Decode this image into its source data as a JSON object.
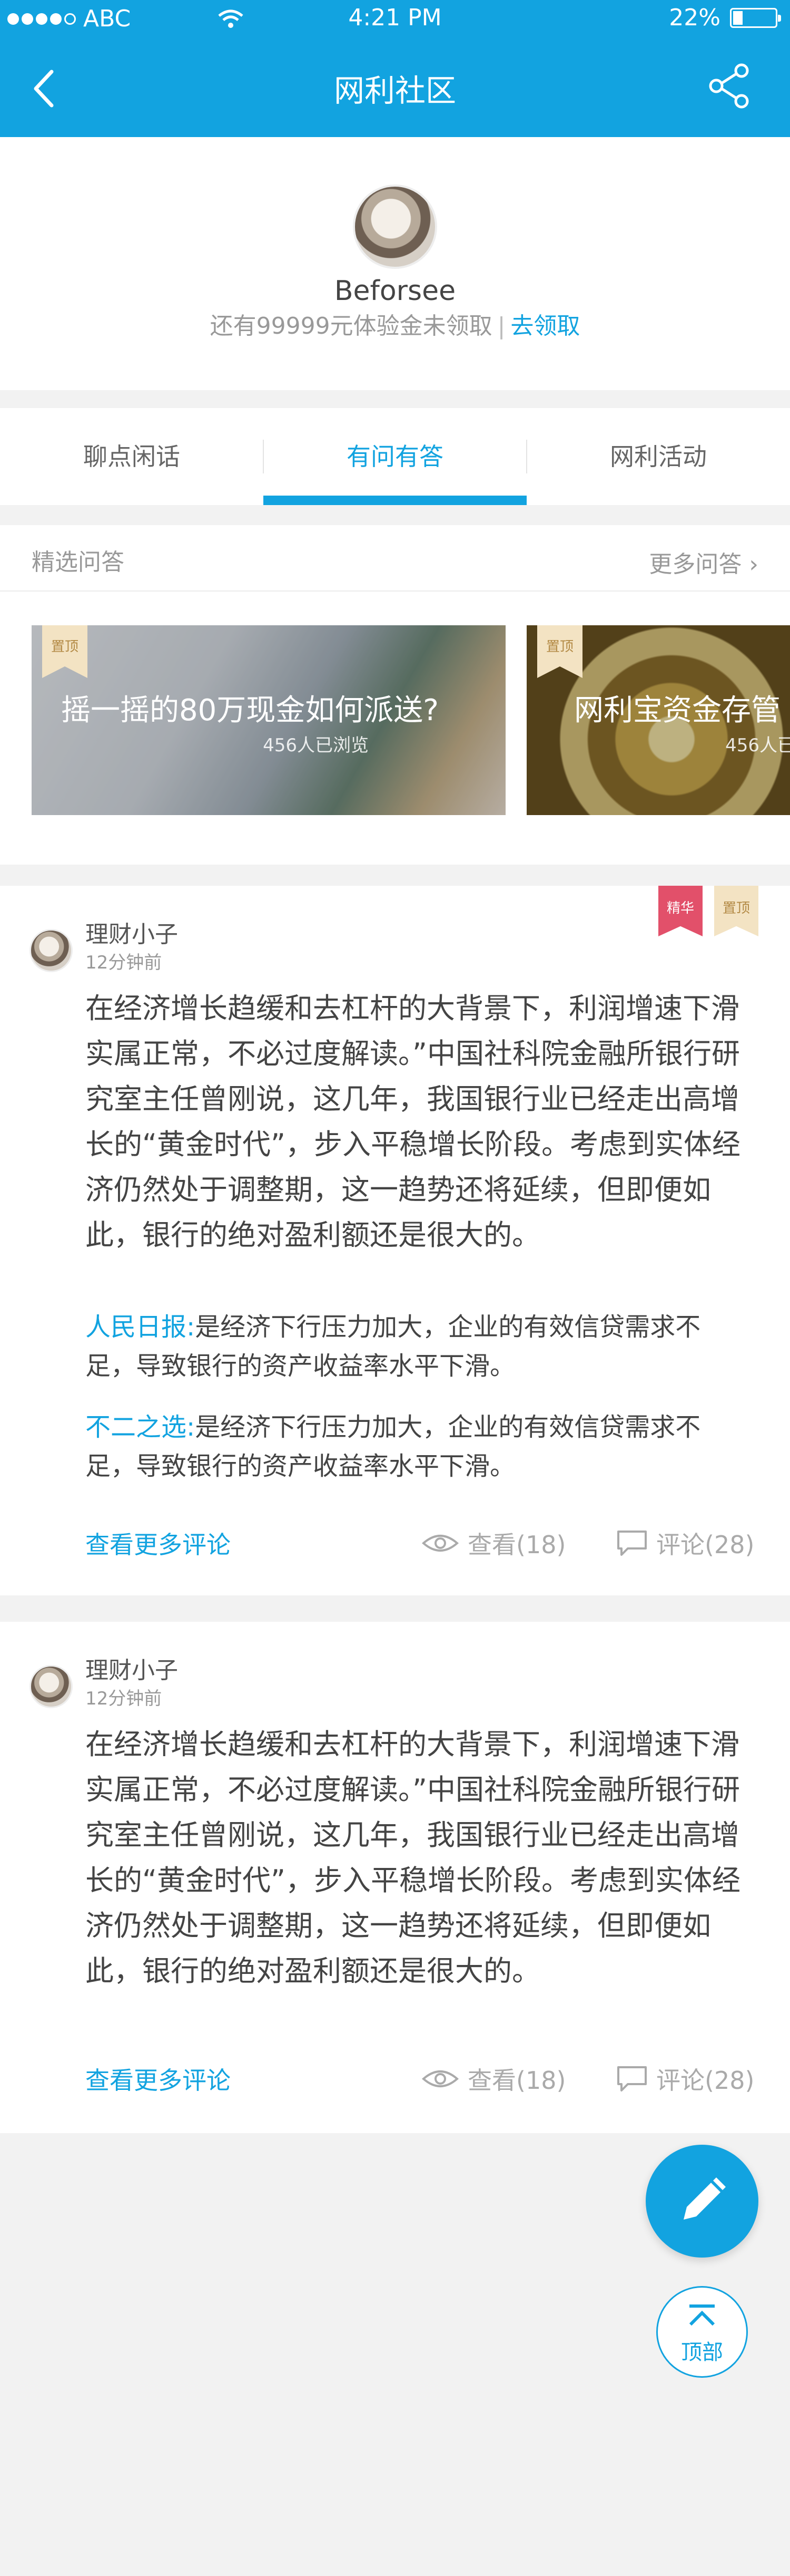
{
  "status_bar": {
    "carrier": "ABC",
    "time": "4:21 PM",
    "battery": "22%"
  },
  "nav": {
    "title": "网利社区"
  },
  "profile": {
    "username": "Beforsee",
    "bonus_text": "还有99999元体验金未领取",
    "bonus_link": "去领取"
  },
  "tabs": [
    {
      "label": "聊点闲话"
    },
    {
      "label": "有问有答"
    },
    {
      "label": "网利活动"
    }
  ],
  "featured": {
    "label": "精选问答",
    "more": "更多问答 ›",
    "cards": [
      {
        "title": "摇一摇的80万现金如何派送?",
        "views": "456人已浏览",
        "pin": "置顶"
      },
      {
        "title": "网利宝资金存管",
        "views": "456人已",
        "pin": "置顶"
      }
    ]
  },
  "posts": [
    {
      "author": "理财小子",
      "time": "12分钟前",
      "badge_featured": "精华",
      "badge_pin": "置顶",
      "body": "在经济增长趋缓和去杠杆的大背景下，利润增速下滑实属正常，不必过度解读。”中国社科院金融所银行研究室主任曾刚说，这几年，我国银行业已经走出高增长的“黄金时代”，步入平稳增长阶段。考虑到实体经济仍然处于调整期，这一趋势还将延续，但即便如此，银行的绝对盈利额还是很大的。",
      "comments": [
        {
          "who": "人民日报:",
          "text": "是经济下行压力加大，企业的有效信贷需求不足，导致银行的资产收益率水平下滑。"
        },
        {
          "who": "不二之选:",
          "text": "是经济下行压力加大，企业的有效信贷需求不足，导致银行的资产收益率水平下滑。"
        }
      ],
      "more_comments": "查看更多评论",
      "views": "查看(18)",
      "replies": "评论(28)"
    },
    {
      "author": "理财小子",
      "time": "12分钟前",
      "body": "在经济增长趋缓和去杠杆的大背景下，利润增速下滑实属正常，不必过度解读。”中国社科院金融所银行研究室主任曾刚说，这几年，我国银行业已经走出高增长的“黄金时代”，步入平稳增长阶段。考虑到实体经济仍然处于调整期，这一趋势还将延续，但即便如此，银行的绝对盈利额还是很大的。",
      "more_comments": "查看更多评论",
      "views": "查看(18)",
      "replies": "评论(28)"
    }
  ],
  "fab": {
    "top_label": "顶部"
  },
  "colors": {
    "accent": "#12a3e0",
    "featured_badge": "#e2506a",
    "pin_badge": "#f3e3c3"
  }
}
